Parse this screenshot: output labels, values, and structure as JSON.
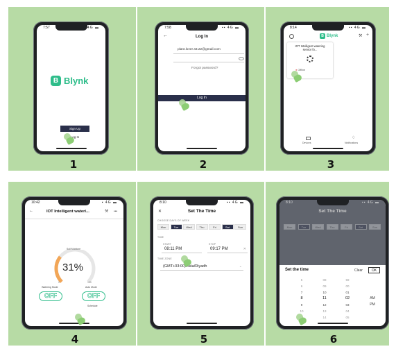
{
  "steps": [
    "1",
    "2",
    "3",
    "4",
    "5",
    "6"
  ],
  "s1": {
    "status_time": "7:57",
    "status_right": "▪▪ 4G ▬",
    "logo_letter": "B",
    "logo_text": "Blynk",
    "signup": "Sign Up",
    "login": "Log In"
  },
  "s2": {
    "status_time": "7:58",
    "status_right": "▪▪ 4G ▬",
    "back": "←",
    "title": "Log In",
    "email": "plant.lover.43.22@gmail.com",
    "forgot": "Forgot password?",
    "login": "Log In"
  },
  "s3": {
    "status_time": "8:14",
    "status_right": "▪▪ 4G ▬",
    "logo_letter": "B",
    "logo_text": "Blynk",
    "card_title": "IOT Intelligent watering sensor fo...",
    "offline": "Offline",
    "tab_devices": "Devices",
    "tab_notifications": "Notifications",
    "colors": {
      "offline": "#e05454"
    }
  },
  "s4": {
    "status_time": "10:42",
    "status_right": "▪ 4G ▬",
    "back": "←",
    "title": "IOT Intelligent wateri...",
    "more": "•••",
    "gauge_label": "Soil Moisture",
    "gauge_value": "31%",
    "gauge_min": "0",
    "gauge_max": "100",
    "gauge_fraction": 0.31,
    "left_label": "Watering Mode",
    "right_label": "Auto Mode",
    "left_toggle": "OFF",
    "right_toggle": "OFF",
    "extra_label": "Schedule",
    "colors": {
      "gauge": "#f2a657",
      "toggle": "#2ebd8a"
    }
  },
  "s5": {
    "status_time": "8:10",
    "status_right": "▪▪ 4G ▬",
    "close": "✕",
    "title": "Set The Time",
    "days_header": "CHOOSE DAYS OF WEEK",
    "days": [
      "Mon",
      "Tue",
      "Wed",
      "Thu",
      "Fri",
      "Sat",
      "Sun"
    ],
    "selected_days": [
      "Tue",
      "Sat"
    ],
    "time_header": "TIME",
    "start_label": "START",
    "stop_label": "STOP",
    "start_time": "08:11 PM",
    "stop_time": "09:17 PM",
    "tz_header": "TIME ZONE",
    "timezone": "(GMT+03:00) Asia/Riyadh"
  },
  "s6": {
    "status_time": "8:10",
    "status_right": "▪▪ 4G ▬",
    "title": "Set The Time",
    "dialog_title": "Set the time",
    "clear": "Clear",
    "ok": "OK",
    "hours": [
      "5",
      "6",
      "7",
      "8",
      "9",
      "10",
      "11"
    ],
    "minutes": [
      "08",
      "09",
      "10",
      "11",
      "12",
      "13",
      "14"
    ],
    "seconds": [
      "59",
      "00",
      "01",
      "02",
      "03",
      "04",
      "05"
    ],
    "ampm": [
      "AM",
      "PM"
    ],
    "selected": {
      "hour": "8",
      "minute": "11",
      "second": "02"
    }
  }
}
